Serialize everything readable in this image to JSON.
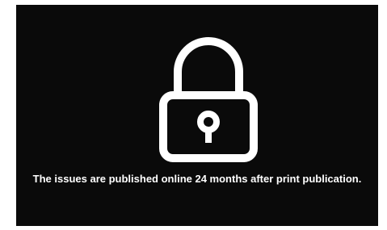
{
  "overlay": {
    "icon": "lock-icon",
    "message": "The issues are published online 24 months after print publication.",
    "colors": {
      "background": "#0a0a0a",
      "foreground": "#ffffff"
    }
  }
}
